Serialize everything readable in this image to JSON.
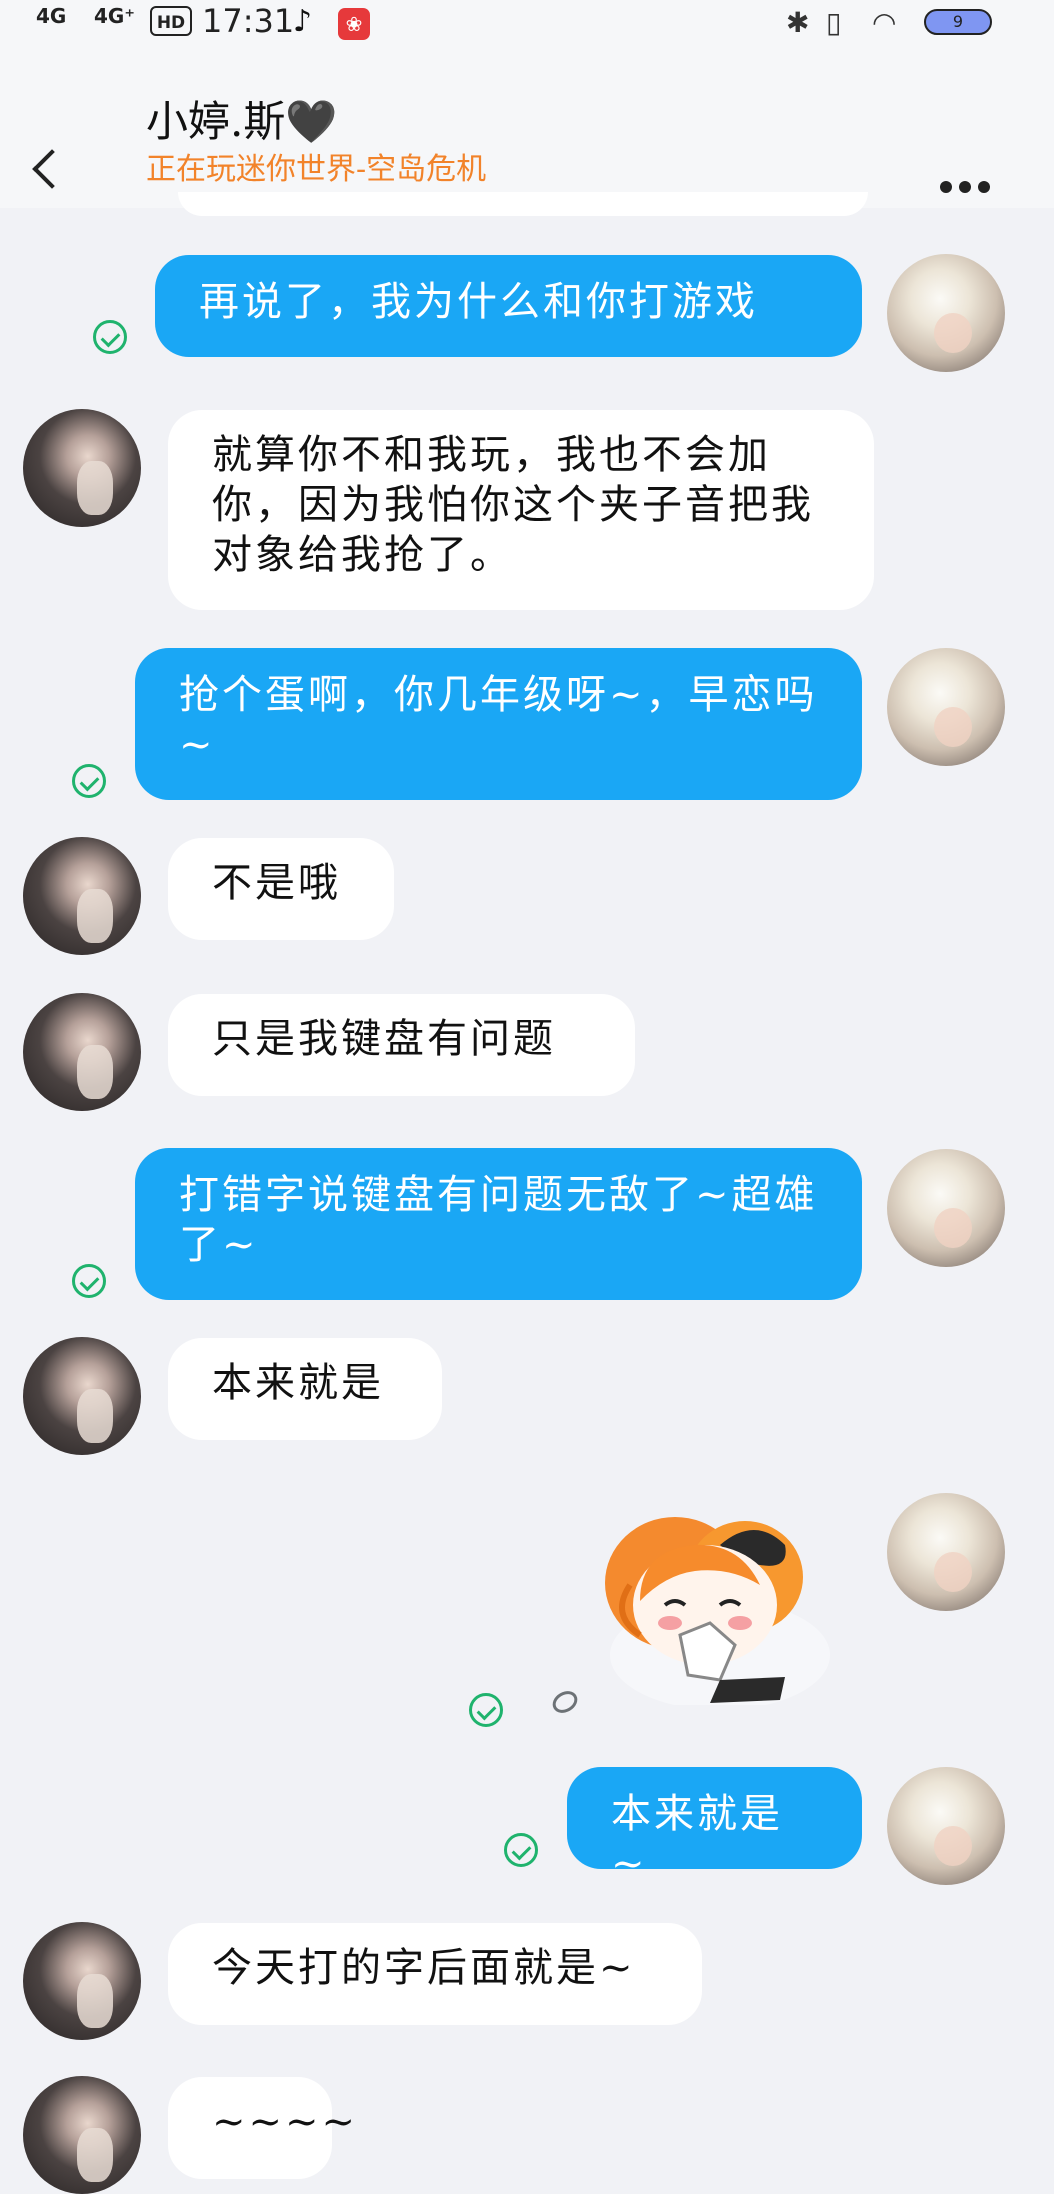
{
  "status_bar": {
    "net1": "4G",
    "net2": "4G⁺",
    "hd": "HD",
    "time": "17:31",
    "tiktok_glyph": "♪",
    "app_glyph": "❀",
    "bt_glyph": "✱",
    "vibrate_glyph": "▯",
    "wifi_glyph": "◠",
    "battery": "9"
  },
  "header": {
    "name": "小婷.斯🖤",
    "status": "正在玩迷你世界-空岛危机"
  },
  "messages": [
    {
      "from": "me",
      "text": "再说了，我为什么和你打游戏"
    },
    {
      "from": "them",
      "text": "就算你不和我玩，我也不会加你，因为我怕你这个夹子音把我对象给我抢了。"
    },
    {
      "from": "me",
      "text": "抢个蛋啊，你几年级呀~，早恋吗~"
    },
    {
      "from": "them",
      "text": "不是哦"
    },
    {
      "from": "them",
      "text": "只是我键盘有问题"
    },
    {
      "from": "me",
      "text": "打错字说键盘有问题无敌了~超雄了~"
    },
    {
      "from": "them",
      "text": "本来就是"
    },
    {
      "from": "me",
      "type": "sticker",
      "text": ""
    },
    {
      "from": "me",
      "text": "本来就是~"
    },
    {
      "from": "them",
      "text": "今天打的字后面就是~"
    },
    {
      "from": "them",
      "text": "~~~~"
    }
  ],
  "colors": {
    "me_bubble": "#1aa7f5",
    "them_bubble": "#ffffff",
    "background": "#f1f2f6",
    "status_accent": "#f2832a",
    "read_check": "#1fb36d"
  }
}
